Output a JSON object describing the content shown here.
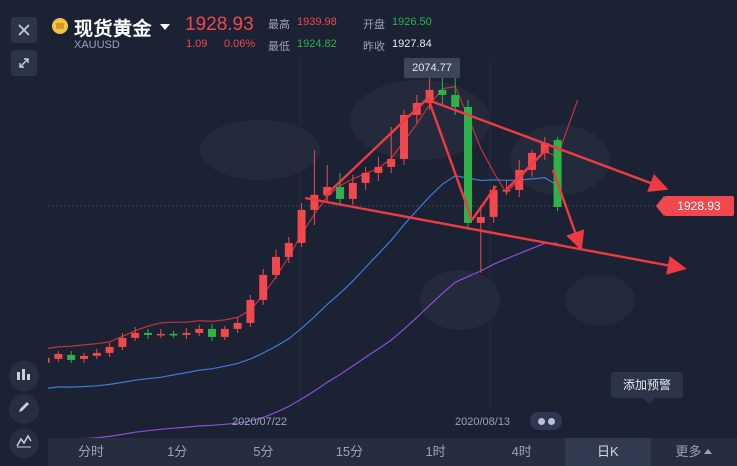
{
  "header": {
    "symbol_name": "现货黄金",
    "symbol_code": "XAUUSD",
    "price": "1928.93",
    "change": "1.09",
    "change_pct": "0.06%",
    "high_label": "最高",
    "high_value": "1939.98",
    "low_label": "最低",
    "low_value": "1924.82",
    "open_label": "开盘",
    "open_value": "1926.50",
    "prev_close_label": "昨收",
    "prev_close_value": "1927.84"
  },
  "chart": {
    "peak_label": "2074.77",
    "current_price_tag": "1928.93",
    "date_labels": [
      "2020/07/22",
      "2020/08/13"
    ],
    "alert_button": "添加预警",
    "colors": {
      "up": "#f0484c",
      "down": "#2fb24a",
      "ma_blue": "#3f7bd8",
      "ma_purple": "#8b4fd9",
      "ma_red": "#c2343e",
      "trend_arrow": "#ee3b43",
      "background": "#1b2233"
    }
  },
  "chart_data": {
    "type": "candlestick",
    "candles": [
      {
        "o": 1768,
        "c": 1772,
        "h": 1775,
        "l": 1764
      },
      {
        "o": 1770,
        "c": 1774,
        "h": 1777,
        "l": 1766
      },
      {
        "o": 1772,
        "c": 1777,
        "h": 1779,
        "l": 1768
      },
      {
        "o": 1776,
        "c": 1781,
        "h": 1784,
        "l": 1773
      },
      {
        "o": 1780,
        "c": 1775,
        "h": 1784,
        "l": 1772
      },
      {
        "o": 1776,
        "c": 1779,
        "h": 1782,
        "l": 1772
      },
      {
        "o": 1779,
        "c": 1782,
        "h": 1786,
        "l": 1776
      },
      {
        "o": 1782,
        "c": 1788,
        "h": 1792,
        "l": 1778
      },
      {
        "o": 1788,
        "c": 1797,
        "h": 1802,
        "l": 1785
      },
      {
        "o": 1797,
        "c": 1802,
        "h": 1808,
        "l": 1794
      },
      {
        "o": 1802,
        "c": 1800,
        "h": 1806,
        "l": 1796
      },
      {
        "o": 1800,
        "c": 1801,
        "h": 1806,
        "l": 1797
      },
      {
        "o": 1801,
        "c": 1800,
        "h": 1804,
        "l": 1797
      },
      {
        "o": 1800,
        "c": 1802,
        "h": 1807,
        "l": 1796
      },
      {
        "o": 1802,
        "c": 1806,
        "h": 1810,
        "l": 1799
      },
      {
        "o": 1806,
        "c": 1798,
        "h": 1811,
        "l": 1794
      },
      {
        "o": 1798,
        "c": 1806,
        "h": 1809,
        "l": 1795
      },
      {
        "o": 1806,
        "c": 1812,
        "h": 1818,
        "l": 1802
      },
      {
        "o": 1812,
        "c": 1835,
        "h": 1840,
        "l": 1808
      },
      {
        "o": 1835,
        "c": 1860,
        "h": 1866,
        "l": 1830
      },
      {
        "o": 1860,
        "c": 1878,
        "h": 1885,
        "l": 1856
      },
      {
        "o": 1878,
        "c": 1892,
        "h": 1898,
        "l": 1872
      },
      {
        "o": 1892,
        "c": 1925,
        "h": 1932,
        "l": 1888
      },
      {
        "o": 1925,
        "c": 1940,
        "h": 1985,
        "l": 1910
      },
      {
        "o": 1940,
        "c": 1948,
        "h": 1970,
        "l": 1932
      },
      {
        "o": 1948,
        "c": 1936,
        "h": 1962,
        "l": 1930
      },
      {
        "o": 1936,
        "c": 1952,
        "h": 1960,
        "l": 1930
      },
      {
        "o": 1952,
        "c": 1962,
        "h": 1968,
        "l": 1945
      },
      {
        "o": 1962,
        "c": 1968,
        "h": 1978,
        "l": 1954
      },
      {
        "o": 1968,
        "c": 1976,
        "h": 2008,
        "l": 1962
      },
      {
        "o": 1976,
        "c": 2020,
        "h": 2025,
        "l": 1970
      },
      {
        "o": 2020,
        "c": 2032,
        "h": 2040,
        "l": 2012
      },
      {
        "o": 2032,
        "c": 2045,
        "h": 2060,
        "l": 2025
      },
      {
        "o": 2045,
        "c": 2040,
        "h": 2074.77,
        "l": 2030
      },
      {
        "o": 2040,
        "c": 2028,
        "h": 2060,
        "l": 2020
      },
      {
        "o": 2028,
        "c": 1912,
        "h": 2035,
        "l": 1905
      },
      {
        "o": 1912,
        "c": 1918,
        "h": 1930,
        "l": 1862
      },
      {
        "o": 1918,
        "c": 1945,
        "h": 1950,
        "l": 1912
      },
      {
        "o": 1945,
        "c": 1945,
        "h": 1955,
        "l": 1940
      },
      {
        "o": 1945,
        "c": 1965,
        "h": 1975,
        "l": 1938
      },
      {
        "o": 1965,
        "c": 1982,
        "h": 1985,
        "l": 1958
      },
      {
        "o": 1982,
        "c": 1992,
        "h": 1998,
        "l": 1975
      },
      {
        "o": 1995,
        "c": 1928,
        "h": 1998,
        "l": 1924
      }
    ],
    "current_price": 1928.93,
    "date_labels": [
      "2020/07/22",
      "2020/08/13"
    ]
  },
  "toolbar": {
    "close_icon": "close-icon",
    "expand_icon": "expand-icon",
    "indicator_icon": "indicator-icon",
    "draw_icon": "pencil-icon",
    "chart_type_icon": "line-chart-icon"
  },
  "tabs": [
    {
      "label": "分时"
    },
    {
      "label": "1分"
    },
    {
      "label": "5分"
    },
    {
      "label": "15分"
    },
    {
      "label": "1时"
    },
    {
      "label": "4时"
    },
    {
      "label": "日K"
    },
    {
      "label": "更多"
    }
  ]
}
